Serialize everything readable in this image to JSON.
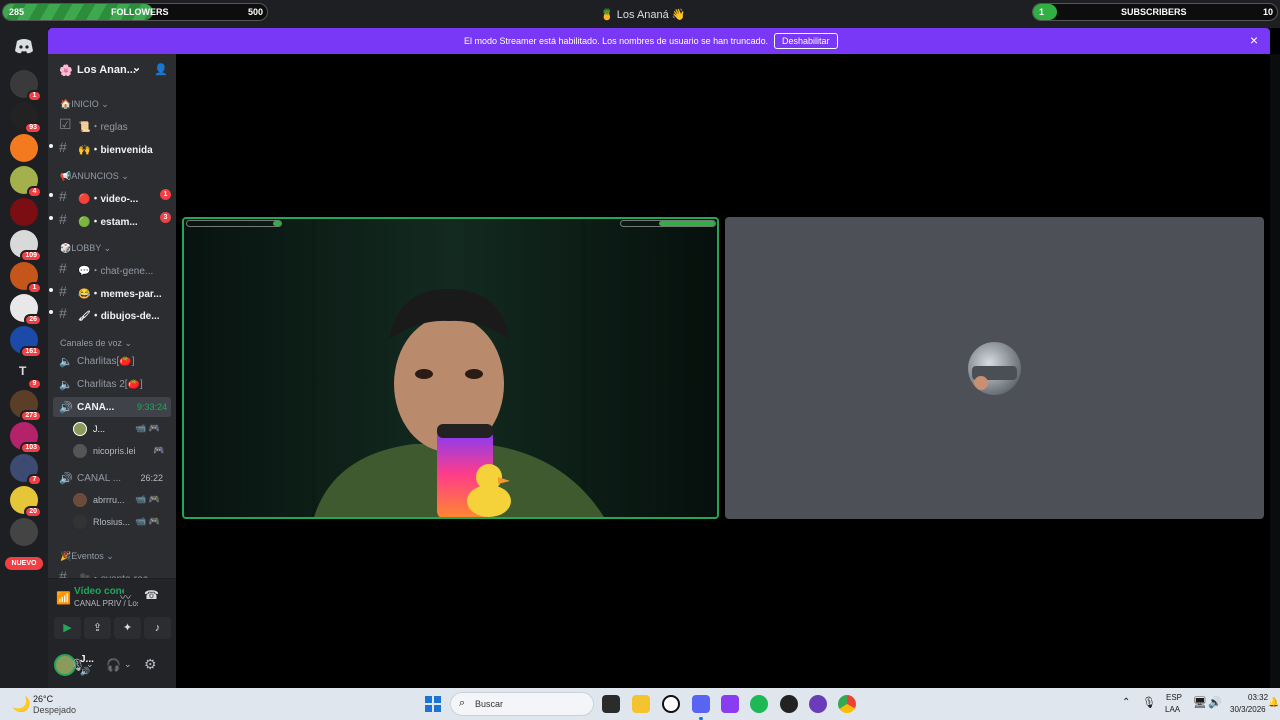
{
  "overlay": {
    "followers": {
      "current": "285",
      "label": "FOLLOWERS",
      "goal": "500",
      "progress": 0.57
    },
    "subscribers": {
      "current": "1",
      "label": "SUBSCRIBERS",
      "goal": "10",
      "progress": 0.1
    }
  },
  "window": {
    "title": "Los Ananá",
    "title_icon": "pineapple-emoji",
    "title_suffix_icon": "hand-emoji"
  },
  "streamer_banner": {
    "text": "El modo Streamer está habilitado. Los nombres de usuario se han truncado.",
    "button": "Deshabilitar",
    "close_icon": "×"
  },
  "servers": [
    {
      "name": "server-1",
      "badge": "1",
      "color": "#3a3a3a"
    },
    {
      "name": "server-skull",
      "badge": "93",
      "color": "#222"
    },
    {
      "name": "server-k",
      "badge": "",
      "color": "#f47a1f"
    },
    {
      "name": "server-4",
      "badge": "4",
      "color": "#a3b04b"
    },
    {
      "name": "server-5",
      "badge": "",
      "color": "#7a0e12"
    },
    {
      "name": "server-6",
      "badge": "109",
      "color": "#d9d9d9"
    },
    {
      "name": "server-7",
      "badge": "1",
      "color": "#c4561b"
    },
    {
      "name": "server-8",
      "badge": "26",
      "color": "#e8e8e8"
    },
    {
      "name": "server-9",
      "badge": "161",
      "color": "#1b4aa8"
    },
    {
      "name": "server-t",
      "badge": "9",
      "color": "#1e1f22",
      "letter": "T"
    },
    {
      "name": "server-11",
      "badge": "273",
      "color": "#5a3e28"
    },
    {
      "name": "server-12",
      "badge": "103",
      "color": "#b4236a"
    },
    {
      "name": "server-13",
      "badge": "7",
      "color": "#3d4a72"
    },
    {
      "name": "server-14",
      "badge": "20",
      "color": "#e5c638"
    },
    {
      "name": "server-15",
      "badge": "",
      "color": "#444"
    }
  ],
  "nuevo_label": "NUEVO",
  "server_header": {
    "name": "Los Anan...",
    "chevron": "⌄"
  },
  "categories": [
    {
      "label": "🏠INICIO",
      "channels": [
        {
          "name": "📜・reglas",
          "unread": false,
          "count": ""
        },
        {
          "name": "🙌・bienvenida",
          "unread": true,
          "count": ""
        }
      ]
    },
    {
      "label": "📢ANUNCIOS",
      "channels": [
        {
          "name": "🔴・video-...",
          "unread": true,
          "count": "1"
        },
        {
          "name": "🟢・estam...",
          "unread": true,
          "count": "3"
        }
      ]
    },
    {
      "label": "🎲LOBBY",
      "channels": [
        {
          "name": "💬・chat-gene...",
          "unread": false,
          "count": ""
        },
        {
          "name": "😂・memes-par...",
          "unread": true,
          "count": ""
        },
        {
          "name": "🖌・dibujos-de...",
          "unread": true,
          "count": ""
        }
      ]
    }
  ],
  "voice_category": "Canales de voz",
  "voice_channels": [
    {
      "name": "Charlitas[🍅]",
      "active": false,
      "timer": "",
      "members": []
    },
    {
      "name": "Charlitas 2[🍅]",
      "active": false,
      "timer": "",
      "members": []
    },
    {
      "name": "CANA...",
      "active": true,
      "timer": "9:33:24",
      "members": [
        {
          "name": "J...",
          "icons": "📹 🎮"
        },
        {
          "name": "nicopris.lei",
          "icons": "🎮"
        }
      ]
    },
    {
      "name": "CANAL ...",
      "active": false,
      "timer": "26:22",
      "members": [
        {
          "name": "abrrru...",
          "icons": "📹 🎮"
        },
        {
          "name": "Rlosius...",
          "icons": "📹 🎮"
        }
      ]
    }
  ],
  "events_category": {
    "label": "🎉Eventos",
    "channel": "🎥・evento-rea..."
  },
  "voice_panel": {
    "status": "Vídeo conectado",
    "location": "CANAL PRIV / Los..."
  },
  "user_panel": {
    "name": "J...",
    "status_icon": "🔊"
  },
  "taskbar": {
    "weather_temp": "26°C",
    "weather_desc": "Despejado",
    "search_placeholder": "Buscar",
    "lang_1": "ESP",
    "lang_2": "LAA",
    "time": "03:32",
    "date": "30/3/2026"
  },
  "colors": {
    "discord_purple": "#7838f5",
    "speaking_green": "#23a55a",
    "unread_red": "#f23f43"
  }
}
